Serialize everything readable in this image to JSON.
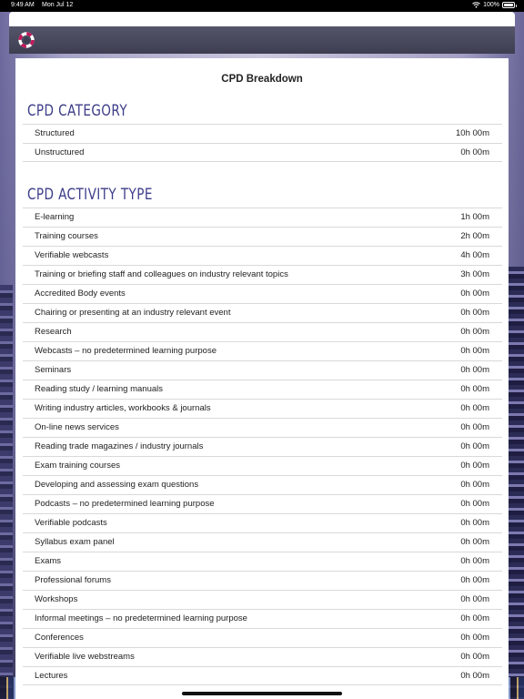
{
  "status_bar": {
    "time": "9:49 AM",
    "date": "Mon Jul 12",
    "battery": "100%"
  },
  "app": {
    "logo_icon": "lifebuoy-icon",
    "accent_color": "#3d3d8a"
  },
  "page": {
    "title": "CPD Breakdown"
  },
  "category_section": {
    "heading": "CPD CATEGORY",
    "rows": [
      {
        "label": "Structured",
        "value": "10h 00m"
      },
      {
        "label": "Unstructured",
        "value": "0h 00m"
      }
    ]
  },
  "activity_section": {
    "heading": "CPD ACTIVITY TYPE",
    "rows": [
      {
        "label": "E-learning",
        "value": "1h 00m"
      },
      {
        "label": "Training courses",
        "value": "2h 00m"
      },
      {
        "label": "Verifiable webcasts",
        "value": "4h 00m"
      },
      {
        "label": "Training or briefing staff and colleagues on industry relevant topics",
        "value": "3h 00m"
      },
      {
        "label": "Accredited Body events",
        "value": "0h 00m"
      },
      {
        "label": "Chairing or presenting at an industry relevant event",
        "value": "0h 00m"
      },
      {
        "label": "Research",
        "value": "0h 00m"
      },
      {
        "label": "Webcasts – no predetermined learning purpose",
        "value": "0h 00m"
      },
      {
        "label": "Seminars",
        "value": "0h 00m"
      },
      {
        "label": "Reading study / learning manuals",
        "value": "0h 00m"
      },
      {
        "label": "Writing industry articles, workbooks & journals",
        "value": "0h 00m"
      },
      {
        "label": "On-line news services",
        "value": "0h 00m"
      },
      {
        "label": "Reading trade magazines / industry journals",
        "value": "0h 00m"
      },
      {
        "label": "Exam training courses",
        "value": "0h 00m"
      },
      {
        "label": "Developing and assessing exam questions",
        "value": "0h 00m"
      },
      {
        "label": "Podcasts – no predetermined learning purpose",
        "value": "0h 00m"
      },
      {
        "label": "Verifiable podcasts",
        "value": "0h 00m"
      },
      {
        "label": "Syllabus exam panel",
        "value": "0h 00m"
      },
      {
        "label": "Exams",
        "value": "0h 00m"
      },
      {
        "label": "Professional forums",
        "value": "0h 00m"
      },
      {
        "label": "Workshops",
        "value": "0h 00m"
      },
      {
        "label": "Informal meetings – no predetermined learning purpose",
        "value": "0h 00m"
      },
      {
        "label": "Conferences",
        "value": "0h 00m"
      },
      {
        "label": "Verifiable live webstreams",
        "value": "0h 00m"
      },
      {
        "label": "Lectures",
        "value": "0h 00m"
      }
    ]
  }
}
